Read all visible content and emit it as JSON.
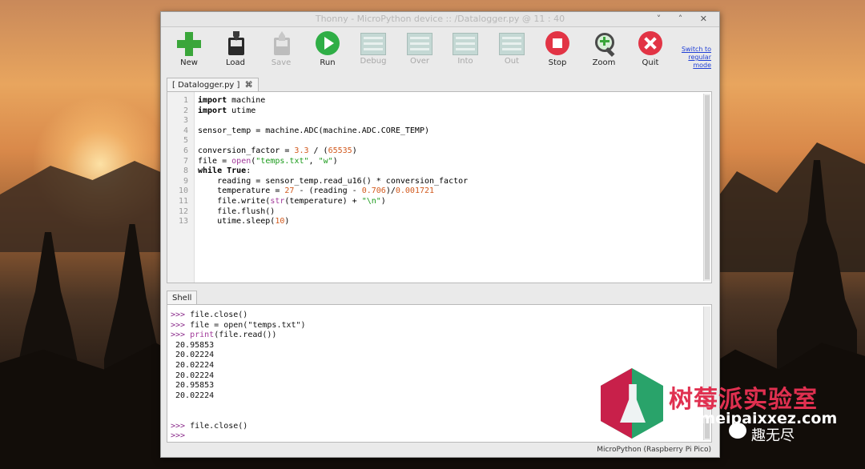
{
  "window": {
    "title": "Thonny  -  MicroPython device :: /Datalogger.py  @  11 : 40",
    "controls": "˅ ˄ ✕"
  },
  "toolbar": {
    "buttons": [
      {
        "label": "New",
        "icon": "new-icon",
        "enabled": true
      },
      {
        "label": "Load",
        "icon": "load-icon",
        "enabled": true
      },
      {
        "label": "Save",
        "icon": "save-icon",
        "enabled": false
      },
      {
        "label": "Run",
        "icon": "run-icon",
        "enabled": true
      },
      {
        "label": "Debug",
        "icon": "debug-icon",
        "enabled": false
      },
      {
        "label": "Over",
        "icon": "step-over-icon",
        "enabled": false
      },
      {
        "label": "Into",
        "icon": "step-into-icon",
        "enabled": false
      },
      {
        "label": "Out",
        "icon": "step-out-icon",
        "enabled": false
      },
      {
        "label": "Stop",
        "icon": "stop-icon",
        "enabled": true
      },
      {
        "label": "Zoom",
        "icon": "zoom-icon",
        "enabled": true
      },
      {
        "label": "Quit",
        "icon": "quit-icon",
        "enabled": true
      }
    ],
    "switch_link": {
      "line1": "Switch to",
      "line2": "regular",
      "line3": "mode"
    }
  },
  "editor": {
    "tab_label": "[ Datalogger.py ]",
    "tab_close": "⌘",
    "line_numbers": [
      "1",
      "2",
      "3",
      "4",
      "5",
      "6",
      "7",
      "8",
      "9",
      "10",
      "11",
      "12",
      "13"
    ]
  },
  "shell": {
    "tab_label": "Shell",
    "prompt": ">>>",
    "cmd1": " file.close()",
    "cmd2": " file = open(\"temps.txt\")",
    "cmd3": " print(file.read())",
    "output": [
      " 20.95853",
      " 20.02224",
      " 20.02224",
      " 20.02224",
      " 20.95853",
      " 20.02224"
    ],
    "cmd4": " file.close()"
  },
  "status": {
    "interpreter": "MicroPython (Raspberry Pi Pico)"
  },
  "watermark": {
    "chinese": "树莓派实验室",
    "url": "shumeipaixxez.com",
    "account": "趣无尽"
  },
  "colors": {
    "keyword": "#000000",
    "number": "#d25a1e",
    "string": "#1a9a1a",
    "builtin": "#a23a9a",
    "run": "#2fae46",
    "stop": "#e23445"
  }
}
